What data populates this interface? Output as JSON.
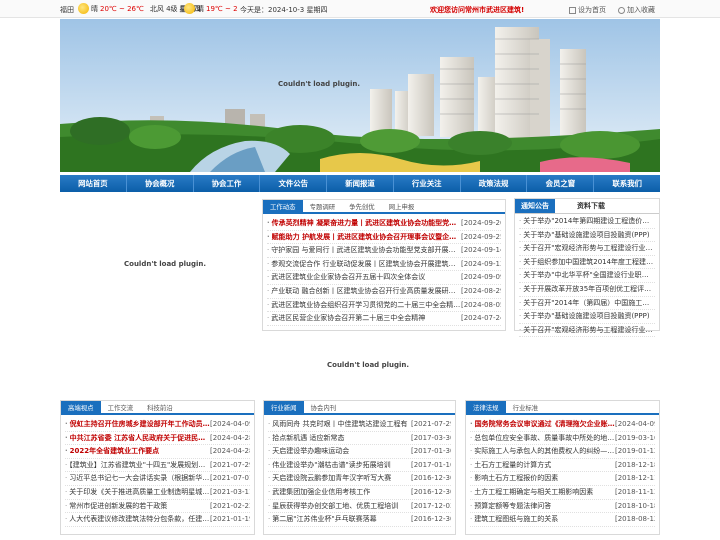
{
  "topbar": {
    "city": "福田",
    "weather_today": {
      "label": "晴",
      "temp": "20℃ ~ 26℃",
      "wind": "北风 4级",
      "day": "星期四"
    },
    "weather_next": {
      "label": "晴",
      "temp": "19℃ ~ 2"
    },
    "today": "今天是：2024-10-3 星期四",
    "welcome": "欢迎您访问常州市武进区建筑!",
    "set_home": "设为首页",
    "add_fav": "加入收藏"
  },
  "banner": {
    "plugin_msg": "Couldn't load plugin."
  },
  "nav": [
    "网站首页",
    "协会概况",
    "协会工作",
    "文件公告",
    "新闻报道",
    "行业关注",
    "政策法规",
    "会员之窗",
    "联系我们"
  ],
  "left_media": {
    "plugin_msg": "Couldn't load plugin."
  },
  "center_media": {
    "plugin_msg": "Couldn't load plugin."
  },
  "work_panel": {
    "tabs": [
      "工作动态",
      "专题调研",
      "争先创优",
      "网上申报"
    ],
    "rows": [
      {
        "title": "传承英烈精神 凝聚奋进力量丨武进区建筑业协会功能型党支部开",
        "date": "[2024-09-26]",
        "hot": true
      },
      {
        "title": "赋能助力 护航发展丨武进区建筑业协会召开理事会议暨企业家座",
        "date": "[2024-09-25]",
        "hot": true
      },
      {
        "title": "守护家园 与爱同行丨武进区建筑业协会功能型党支部开展爱心公",
        "date": "[2024-09-14]",
        "hot": false
      },
      {
        "title": "参观交流促合作 行业联动促发展丨区建筑业协会开展建筑设备产",
        "date": "[2024-09-13]",
        "hot": false
      },
      {
        "title": "武进区建筑业企业家协会召开五届十四次全体会议",
        "date": "[2024-09-09]",
        "hot": false
      },
      {
        "title": "产业联动 融合创新丨区建筑业协会召开行业高质量发展研讨会",
        "date": "[2024-08-29]",
        "hot": false
      },
      {
        "title": "武进区建筑业协会组织召开学习贯彻党的二十届三中全会精神专题",
        "date": "[2024-08-05]",
        "hot": false
      },
      {
        "title": "武进区民营企业家协会召开第二十届三中全会精神",
        "date": "[2024-07-24]",
        "hot": false
      }
    ]
  },
  "notice_panel": {
    "tabs": [
      "通知公告",
      "资料下载"
    ],
    "rows": [
      "关于举办\"2014年第四期建设工程造价……管理\"培训班",
      "关于举办\"基础设施建设项目投融资(PPP)",
      "关于召开\"宏观经济形势与工程建设行业发展高",
      "关于组织参加中国建筑2014年度工程建设企业",
      "关于举办\"中北华平杯\"全国建设行业职业技能",
      "关于开展改革开放35年百项创优工程评选活",
      "关于召开\"2014年（第四届）中国施工装备",
      "关于举办\"基础设施建设项目投融资(PPP)",
      "关于召开\"宏观经济形势与工程建设行业发展"
    ]
  },
  "bottom_left": {
    "tabs": [
      "高端视点",
      "工作交流",
      "科技前沿"
    ],
    "rows": [
      {
        "title": "倪虹主持召开住房城乡建设部开年工作动员会强调",
        "date": "[2024-04-09]",
        "hot": true
      },
      {
        "title": "中共江苏省委 江苏省人民政府关于促进民营经济",
        "date": "[2024-04-28]",
        "hot": true
      },
      {
        "title": "2022年全省建筑业工作要点",
        "date": "[2024-04-28]",
        "hot": true
      },
      {
        "title": "【建筑业】江苏省建筑业\"十四五\"发展规划印发",
        "date": "[2021-07-29]",
        "hot": false
      },
      {
        "title": "习近平总书记七一大会讲话实录（根据新华社文",
        "date": "[2021-07-01]",
        "hot": false
      },
      {
        "title": "关于印发《关于推进高质量工业制造明星城建设的",
        "date": "[2021-03-11]",
        "hot": false
      },
      {
        "title": "常州市促进创新发展的若干政策",
        "date": "[2021-02-23]",
        "hot": false
      },
      {
        "title": "人大代表建议修改建筑法特分包条款，任建部答复",
        "date": "[2021-01-19]",
        "hot": false
      }
    ]
  },
  "bottom_mid": {
    "tabs": [
      "行业新闻",
      "协会内刊"
    ],
    "rows": [
      {
        "title": "风雨同舟 共克时艰丨中佳建筑达建设工程有",
        "date": "[2021-07-29]",
        "hot": false
      },
      {
        "title": "拾点新机遇 适应新常态",
        "date": "[2017-03-30]",
        "hot": false
      },
      {
        "title": "天启建设举办趣味运动会",
        "date": "[2017-01-30]",
        "hot": false
      },
      {
        "title": "伟业建设举办\"潮枯击谱\"读步拓展培训",
        "date": "[2017-01-16]",
        "hot": false
      },
      {
        "title": "天启建设院云鹏参加青年汉字听写大赛",
        "date": "[2016-12-30]",
        "hot": false
      },
      {
        "title": "武建集团加强企业信用考核工作",
        "date": "[2016-12-30]",
        "hot": false
      },
      {
        "title": "星辰获得举办创交部工地、优质工程培训",
        "date": "[2017-12-03]",
        "hot": false
      },
      {
        "title": "第二届\"江苏伟业杯\"乒乓联赛落幕",
        "date": "[2016-12-30]",
        "hot": false
      }
    ]
  },
  "bottom_right": {
    "tabs": [
      "法律法规",
      "行业标准"
    ],
    "rows": [
      {
        "title": "国务院常务会议审议通过《清理拖欠企业账款专项",
        "date": "[2024-04-09]",
        "hot": true
      },
      {
        "title": "总包单位应安全事故、质量事故中所处的地位、",
        "date": "[2019-03-16]",
        "hot": false
      },
      {
        "title": "实际施工人与承包人的其他费权人的纠纷——工程",
        "date": "[2019-01-12]",
        "hot": false
      },
      {
        "title": "土石方工程量的计算方式",
        "date": "[2018-12-18]",
        "hot": false
      },
      {
        "title": "影响土石方工程报价的因素",
        "date": "[2018-12-11]",
        "hot": false
      },
      {
        "title": "土方工程工期确定与相关工期影响因素",
        "date": "[2018-11-13]",
        "hot": false
      },
      {
        "title": "预算定额等专题法律问答",
        "date": "[2018-10-18]",
        "hot": false
      },
      {
        "title": "建筑工程图纸与施工的关系",
        "date": "[2018-08-12]",
        "hot": false
      }
    ]
  }
}
